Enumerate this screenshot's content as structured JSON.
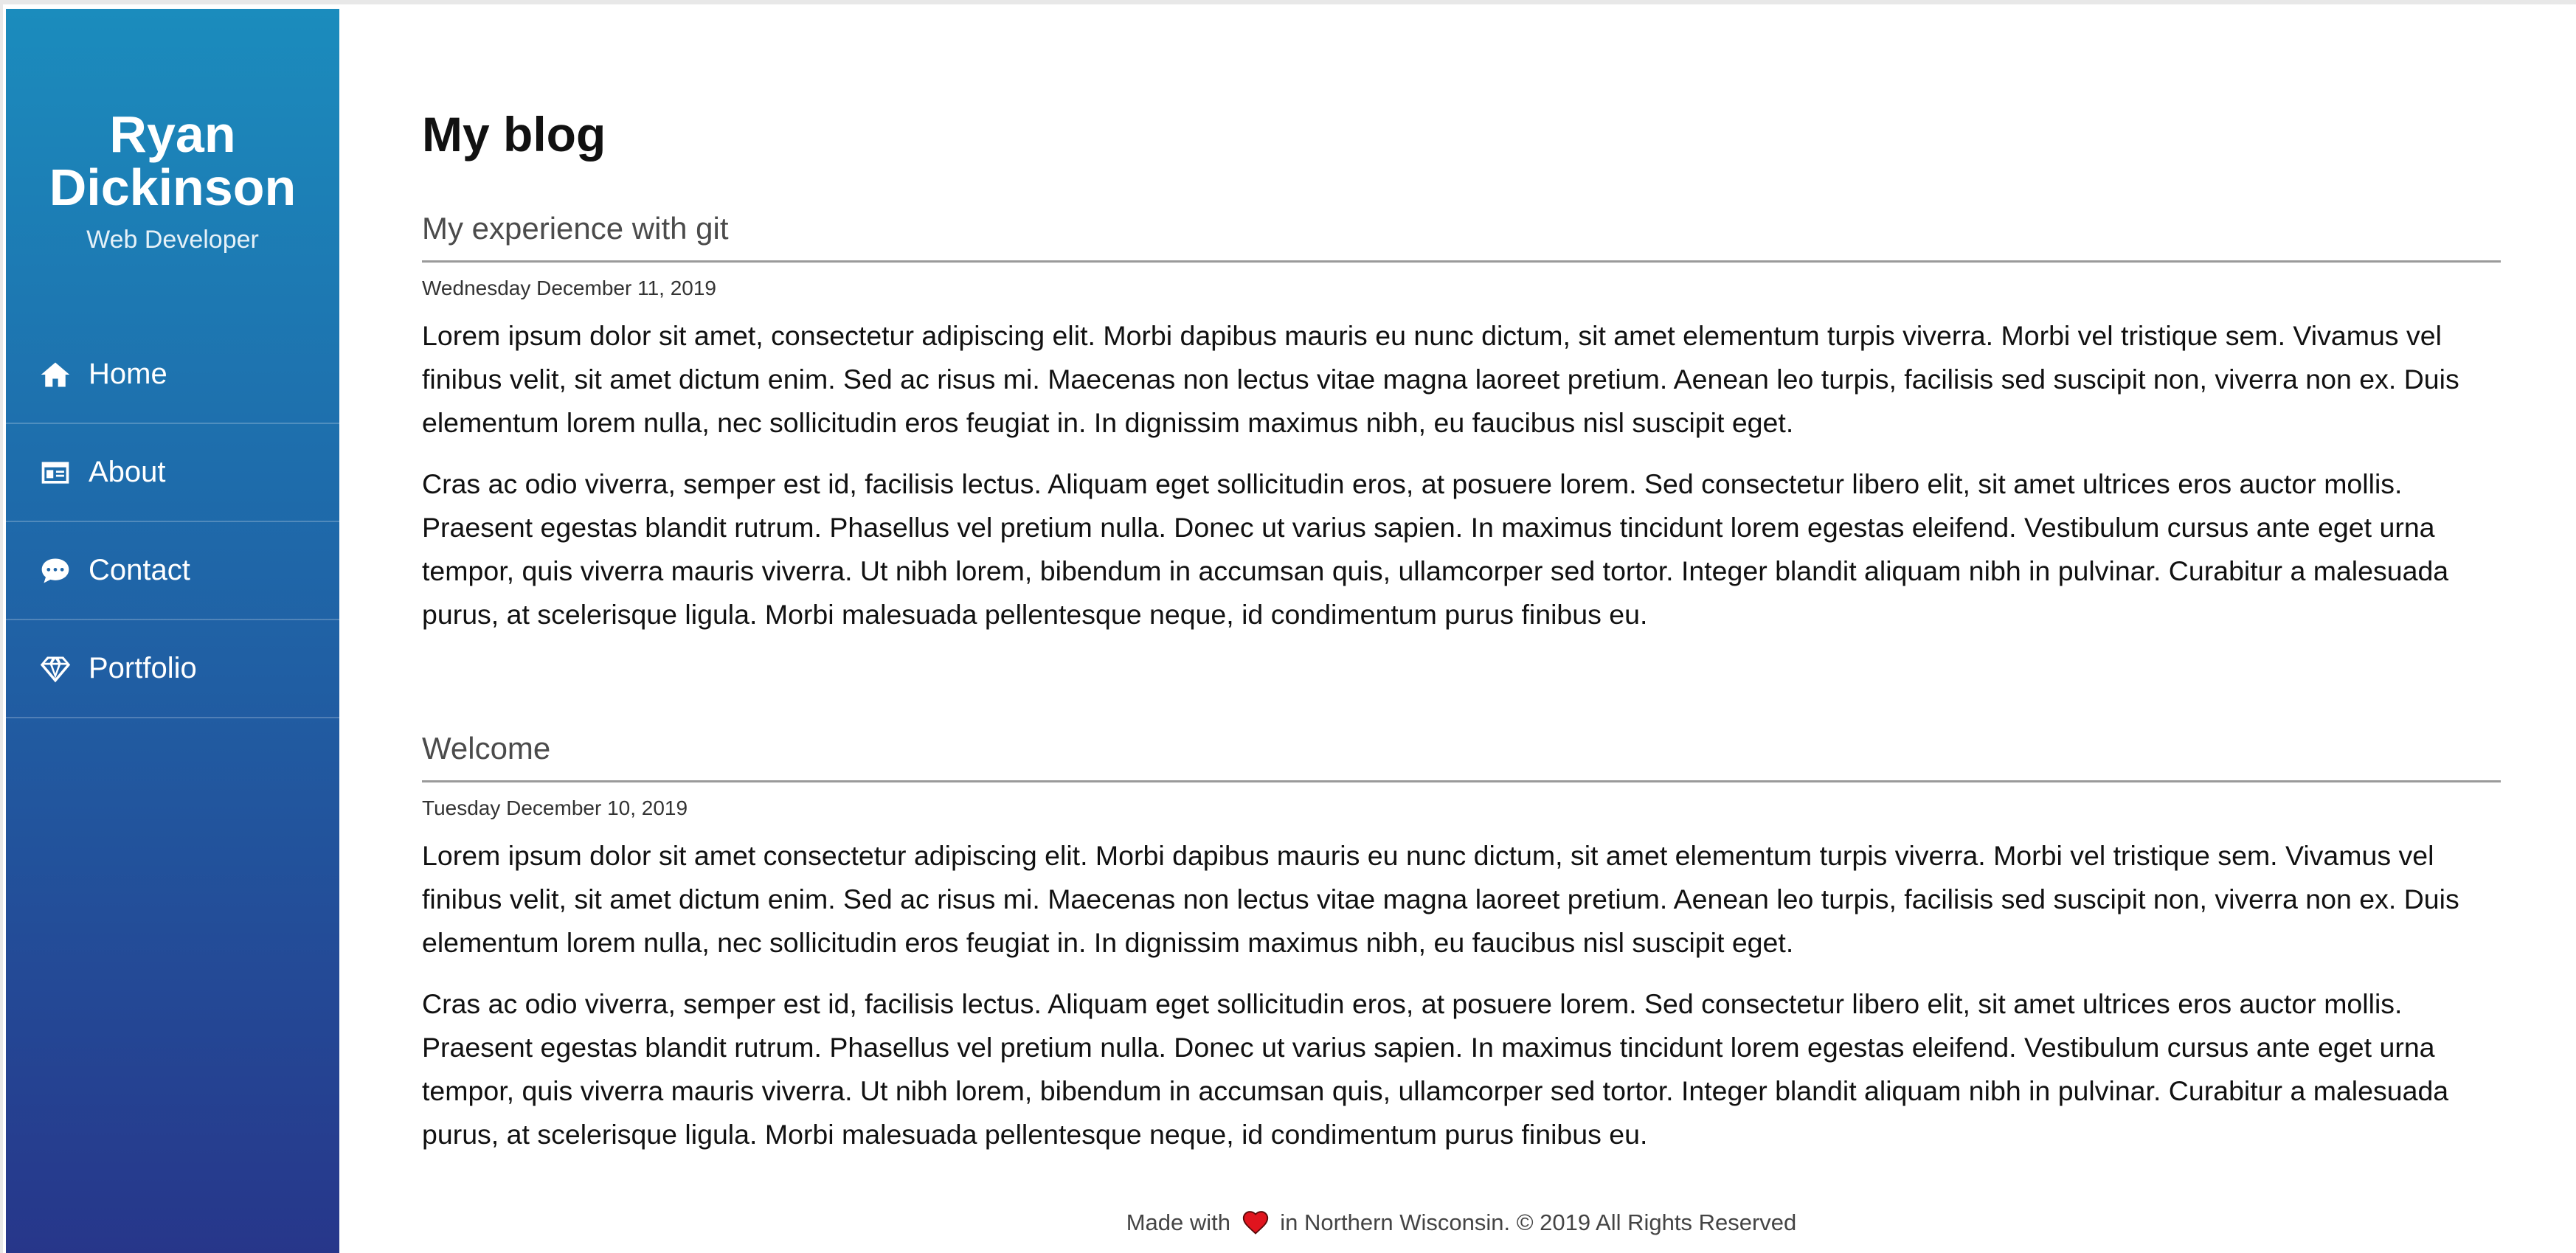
{
  "sidebar": {
    "name": "Ryan Dickinson",
    "role": "Web Developer",
    "nav": [
      {
        "label": "Home",
        "icon": "home-icon"
      },
      {
        "label": "About",
        "icon": "id-card-icon"
      },
      {
        "label": "Contact",
        "icon": "chat-bubble-icon"
      },
      {
        "label": "Portfolio",
        "icon": "gem-icon"
      }
    ],
    "gradient": [
      "#1b8cbd",
      "#1f66a8",
      "#27368a"
    ]
  },
  "main": {
    "title": "My blog",
    "posts": [
      {
        "title": "My experience with git",
        "date": "Wednesday December 11, 2019",
        "paragraphs": [
          "Lorem ipsum dolor sit amet, consectetur adipiscing elit. Morbi dapibus mauris eu nunc dictum, sit amet elementum turpis viverra. Morbi vel tristique sem. Vivamus vel finibus velit, sit amet dictum enim. Sed ac risus mi. Maecenas non lectus vitae magna laoreet pretium. Aenean leo turpis, facilisis sed suscipit non, viverra non ex. Duis elementum lorem nulla, nec sollicitudin eros feugiat in. In dignissim maximus nibh, eu faucibus nisl suscipit eget.",
          "Cras ac odio viverra, semper est id, facilisis lectus. Aliquam eget sollicitudin eros, at posuere lorem. Sed consectetur libero elit, sit amet ultrices eros auctor mollis. Praesent egestas blandit rutrum. Phasellus vel pretium nulla. Donec ut varius sapien. In maximus tincidunt lorem egestas eleifend. Vestibulum cursus ante eget urna tempor, quis viverra mauris viverra. Ut nibh lorem, bibendum in accumsan quis, ullamcorper sed tortor. Integer blandit aliquam nibh in pulvinar. Curabitur a malesuada purus, at scelerisque ligula. Morbi malesuada pellentesque neque, id condimentum purus finibus eu."
        ]
      },
      {
        "title": "Welcome",
        "date": "Tuesday December 10, 2019",
        "paragraphs": [
          "Lorem ipsum dolor sit amet consectetur adipiscing elit. Morbi dapibus mauris eu nunc dictum, sit amet elementum turpis viverra. Morbi vel tristique sem. Vivamus vel finibus velit, sit amet dictum enim. Sed ac risus mi. Maecenas non lectus vitae magna laoreet pretium. Aenean leo turpis, facilisis sed suscipit non, viverra non ex. Duis elementum lorem nulla, nec sollicitudin eros feugiat in. In dignissim maximus nibh, eu faucibus nisl suscipit eget.",
          "Cras ac odio viverra, semper est id, facilisis lectus. Aliquam eget sollicitudin eros, at posuere lorem. Sed consectetur libero elit, sit amet ultrices eros auctor mollis. Praesent egestas blandit rutrum. Phasellus vel pretium nulla. Donec ut varius sapien. In maximus tincidunt lorem egestas eleifend. Vestibulum cursus ante eget urna tempor, quis viverra mauris viverra. Ut nibh lorem, bibendum in accumsan quis, ullamcorper sed tortor. Integer blandit aliquam nibh in pulvinar. Curabitur a malesuada purus, at scelerisque ligula. Morbi malesuada pellentesque neque, id condimentum purus finibus eu."
        ]
      }
    ]
  },
  "footer": {
    "before": "Made with",
    "after": "in Northern Wisconsin. © 2019 All Rights Reserved",
    "heart_icon": "heart-icon",
    "heart_color": "#e0141e"
  }
}
